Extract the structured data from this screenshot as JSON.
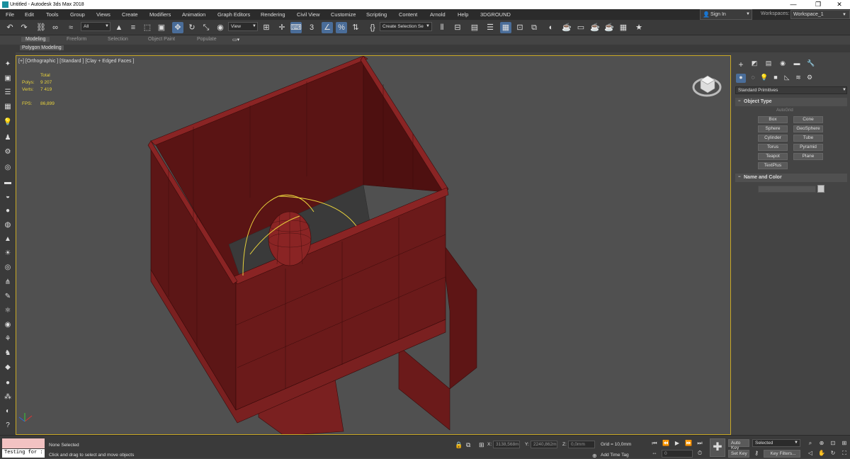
{
  "window": {
    "title": "Untitled - Autodesk 3ds Max 2018",
    "minimize": "—",
    "maximize": "❐",
    "close": "✕"
  },
  "menu": [
    "File",
    "Edit",
    "Tools",
    "Group",
    "Views",
    "Create",
    "Modifiers",
    "Animation",
    "Graph Editors",
    "Rendering",
    "Civil View",
    "Customize",
    "Scripting",
    "Content",
    "Arnold",
    "Help",
    "3DGROUND"
  ],
  "signin": "Sign In",
  "workspaces": {
    "label": "Workspaces:",
    "value": "Workspace_1"
  },
  "toolbar": {
    "filter": "All",
    "view": "View",
    "selection_set": "Create Selection Se"
  },
  "ribbon": {
    "tabs": [
      "Modeling",
      "Freeform",
      "Selection",
      "Object Paint",
      "Populate"
    ],
    "active_tab": "Modeling",
    "subtab": "Polygon Modeling"
  },
  "viewport": {
    "label": "[+] [Orthographic ] [Standard ] [Clay + Edged Faces ]",
    "stats": {
      "total_label": "Total",
      "polys_label": "Polys:",
      "polys_value": "9 207",
      "verts_label": "Verts:",
      "verts_value": "7 419",
      "fps_label": "FPS:",
      "fps_value": "86,899"
    }
  },
  "command_panel": {
    "dropdown": "Standard Primitives",
    "object_type": {
      "title": "Object Type",
      "autogrid": "AutoGrid",
      "buttons": [
        "Box",
        "Cone",
        "Sphere",
        "GeoSphere",
        "Cylinder",
        "Tube",
        "Torus",
        "Pyramid",
        "Teapot",
        "Plane",
        "TextPlus"
      ]
    },
    "name_color": {
      "title": "Name and Color"
    }
  },
  "status": {
    "maxscript": "Testing for :",
    "selection": "None Selected",
    "prompt": "Click and drag to select and move objects",
    "x_label": "X:",
    "x_value": "3138,568m",
    "y_label": "Y:",
    "y_value": "2240,862m",
    "z_label": "Z:",
    "z_value": "0,0mm",
    "grid": "Grid = 10,0mm",
    "add_time_tag": "Add Time Tag",
    "frame": "0",
    "auto_key": "Auto Key",
    "set_key": "Set Key",
    "selected": "Selected",
    "key_filters": "Key Filters..."
  },
  "colors": {
    "model": "#6b1a1a",
    "model_light": "#8a2424",
    "accent": "#c9a825",
    "active_btn": "#4a6d99"
  }
}
